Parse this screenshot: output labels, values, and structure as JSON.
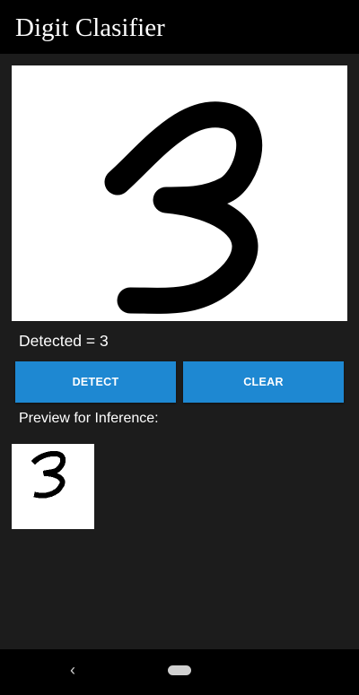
{
  "app": {
    "title": "Digit Clasifier"
  },
  "result": {
    "text": "Detected = 3"
  },
  "buttons": {
    "detect_label": "DETECT",
    "clear_label": "CLEAR"
  },
  "preview": {
    "label": "Preview for Inference:"
  },
  "navigation": {
    "back_icon": "back-chevron-icon",
    "home_icon": "home-pill-icon",
    "back_glyph": "‹"
  },
  "colors": {
    "app_bar": "#000000",
    "background": "#1c1c1c",
    "button": "#1e88d2",
    "canvas": "#ffffff",
    "stroke": "#000000"
  }
}
